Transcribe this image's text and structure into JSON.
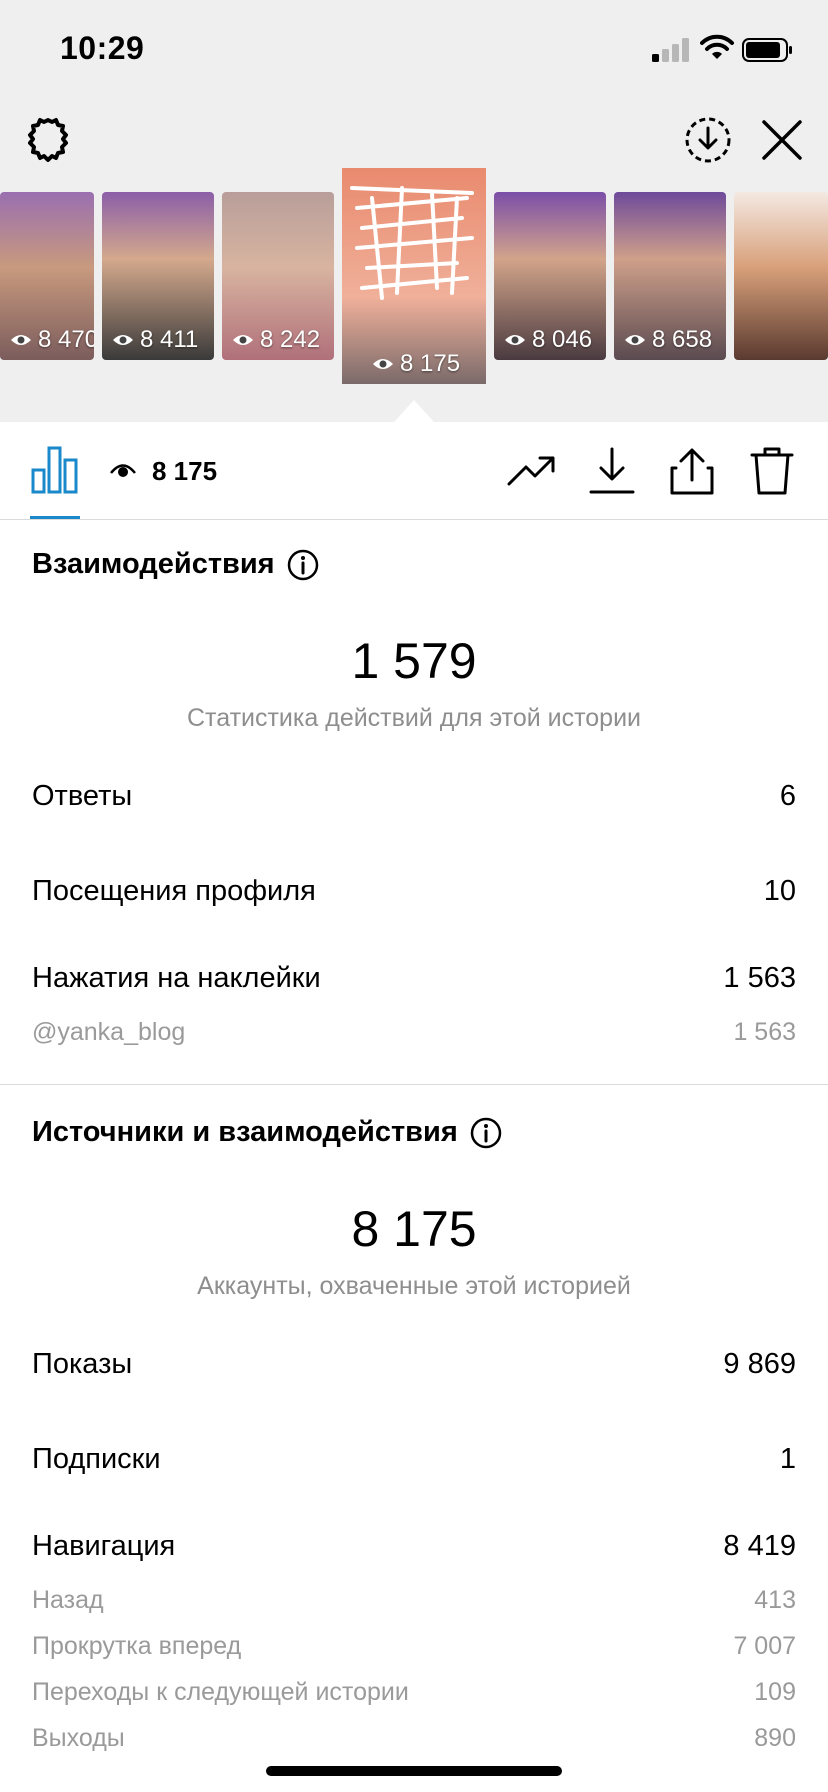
{
  "status": {
    "time": "10:29"
  },
  "thumbnails": [
    {
      "views": "8 470"
    },
    {
      "views": "8 411"
    },
    {
      "views": "8 242"
    },
    {
      "views": "8 175"
    },
    {
      "views": "8 046"
    },
    {
      "views": "8 658"
    },
    {
      "views": ""
    }
  ],
  "toolbar": {
    "views": "8 175"
  },
  "interactions": {
    "title": "Взаимодействия",
    "total": "1 579",
    "subtitle": "Статистика действий для этой истории",
    "rows": [
      {
        "label": "Ответы",
        "value": "6"
      },
      {
        "label": "Посещения профиля",
        "value": "10"
      },
      {
        "label": "Нажатия на наклейки",
        "value": "1 563"
      }
    ],
    "sticker": {
      "label": "@yanka_blog",
      "value": "1 563"
    }
  },
  "discovery": {
    "title": "Источники и взаимодействия",
    "total": "8 175",
    "subtitle": "Аккаунты, охваченные этой историей",
    "rows": [
      {
        "label": "Показы",
        "value": "9 869"
      },
      {
        "label": "Подписки",
        "value": "1"
      },
      {
        "label": "Навигация",
        "value": "8 419"
      }
    ],
    "navigation": [
      {
        "label": "Назад",
        "value": "413"
      },
      {
        "label": "Прокрутка вперед",
        "value": "7 007"
      },
      {
        "label": "Переходы к следующей истории",
        "value": "109"
      },
      {
        "label": "Выходы",
        "value": "890"
      }
    ]
  },
  "colors": {
    "accent": "#1a88ca",
    "muted": "#8e8e8e",
    "divider": "#dbdbdb"
  }
}
